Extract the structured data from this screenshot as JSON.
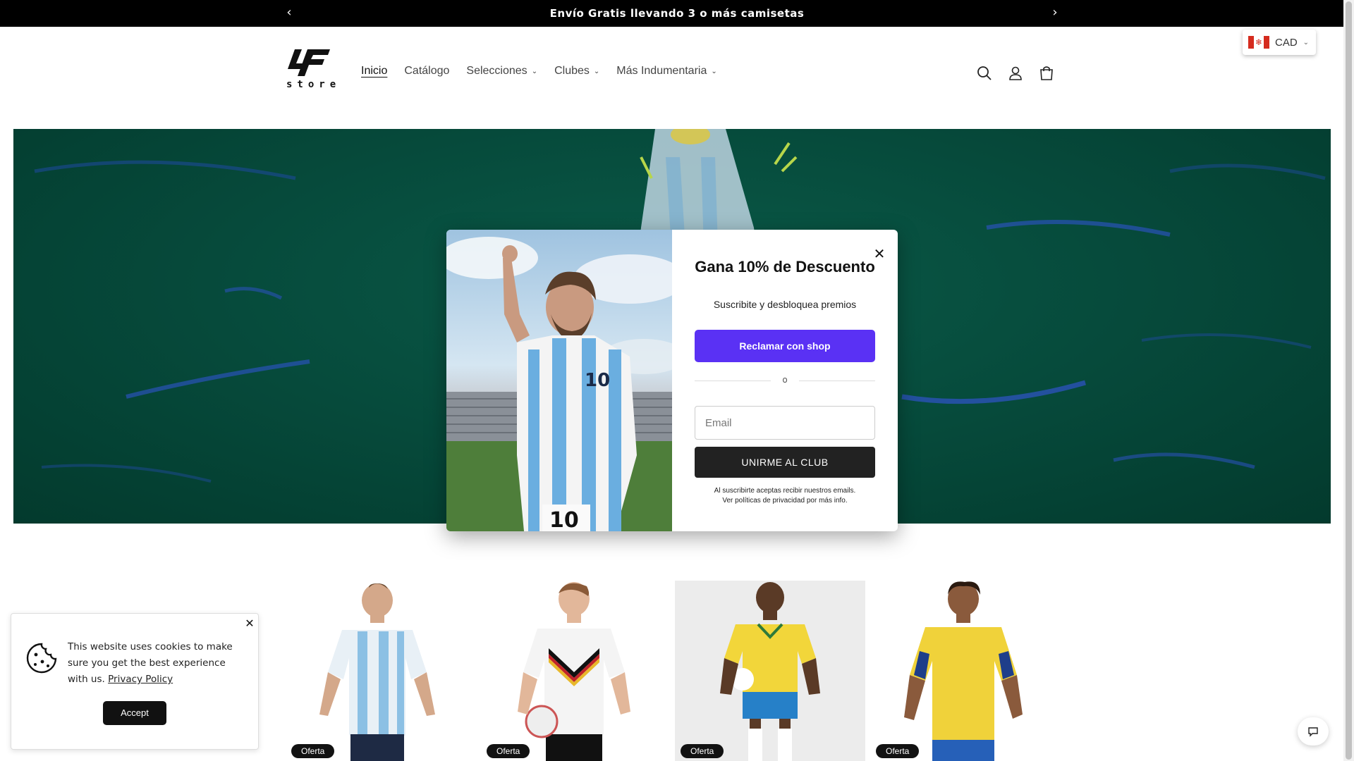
{
  "announcement": {
    "message": "Envío Gratis llevando 3 o más camisetas",
    "prev_icon": "chevron-left-icon",
    "next_icon": "chevron-right-icon"
  },
  "header": {
    "logo_mark": "LF",
    "logo_word": "store",
    "nav": [
      {
        "label": "Inicio",
        "active": true,
        "dropdown": false
      },
      {
        "label": "Catálogo",
        "active": false,
        "dropdown": false
      },
      {
        "label": "Selecciones",
        "active": false,
        "dropdown": true
      },
      {
        "label": "Clubes",
        "active": false,
        "dropdown": true
      },
      {
        "label": "Más Indumentaria",
        "active": false,
        "dropdown": true
      }
    ],
    "icons": [
      "search-icon",
      "account-icon",
      "cart-icon"
    ]
  },
  "currency": {
    "code": "CAD",
    "flag": "canada-flag-icon"
  },
  "modal": {
    "title": "Gana 10% de Descuento",
    "subtitle": "Suscribite y desbloquea premios",
    "shop_button_prefix": "Reclamar con",
    "shop_button_brand": "shop",
    "divider_text": "o",
    "email_placeholder": "Email",
    "join_button": "UNIRME AL CLUB",
    "legal_line1": "Al suscribirte aceptas recibir nuestros emails.",
    "legal_line2": "Ver políticas de privacidad por más info.",
    "shop_color": "#5a31f4",
    "jersey_number": "10"
  },
  "products": [
    {
      "badge": "Oferta"
    },
    {
      "badge": "Oferta"
    },
    {
      "badge": "Oferta"
    },
    {
      "badge": "Oferta"
    }
  ],
  "cookie": {
    "text": "This website uses cookies to make sure you get the best experience with us.",
    "link": "Privacy Policy",
    "accept": "Accept"
  },
  "colors": {
    "hero_green": "#064a3b",
    "announcement_bg": "#000000"
  }
}
